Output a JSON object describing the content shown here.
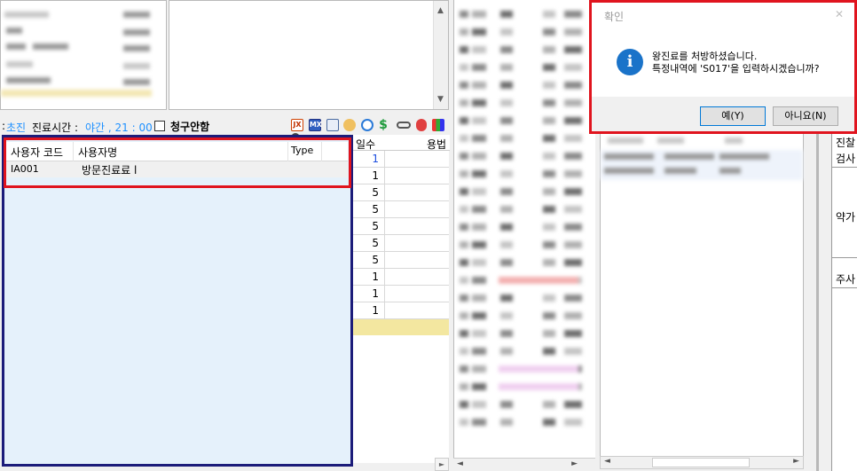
{
  "info_bar": {
    "visit_type_prefix": ":",
    "visit_type": "초진",
    "treatment_time_label": "진료시간 :",
    "treatment_time_value": "야간 , 21 : 00",
    "no_claim_label": "청구안함"
  },
  "popup_list": {
    "columns": [
      "사용자 코드",
      "사용자명",
      "Type"
    ],
    "rows": [
      {
        "code": "IA001",
        "name": "방문진료료 l",
        "type": ""
      }
    ]
  },
  "prescription_grid": {
    "columns": [
      "일수",
      "용법"
    ],
    "quantities": [
      "1",
      "1",
      "5",
      "5",
      "5",
      "5",
      "5",
      "1",
      "1",
      "1"
    ]
  },
  "dialog": {
    "title": "확인",
    "message_line1": "왕진료를 처방하셨습니다.",
    "message_line2": "특정내역에 'S017'을 입력하시겠습니까?",
    "yes_label": "예(Y)",
    "no_label": "아니요(N)",
    "close_glyph": "✕"
  },
  "side_labels": [
    "진찰",
    "검사",
    "약가",
    "주사"
  ],
  "colors": {
    "highlight_red": "#e0141e",
    "navy_border": "#1c1c7a",
    "accent_blue": "#1e90ff",
    "info_icon": "#1a73c9"
  }
}
